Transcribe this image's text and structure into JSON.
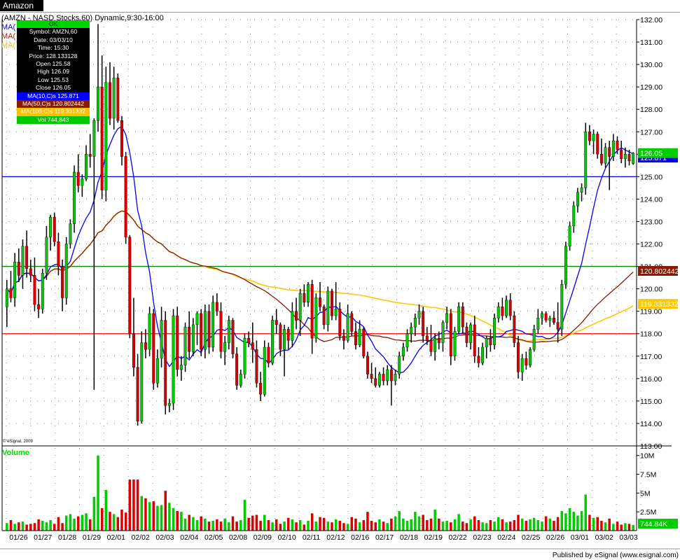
{
  "window": {
    "tab_title": "Amazon"
  },
  "header": {
    "text": "(AMZN - NASD Stocks,60) Dynamic,9:30-16:00"
  },
  "ma_labels": [
    {
      "text": "MA(",
      "color": "#0000ff"
    },
    {
      "text": "MA(",
      "color": "#b22000"
    },
    {
      "text": "MA(",
      "color": "#ffbe00"
    }
  ],
  "cursor": {
    "ok": "OK",
    "symbol": "Symbol: AMZN,60",
    "date": "Date: 03/03/10",
    "time": "Time: 15:30",
    "price": "Price: 128.133128",
    "open": "Open 125.58",
    "high": "High 126.09",
    "low": "Low 125.53",
    "close": "Close 126.05",
    "ma10": "MA(10,C)s 125.871",
    "ma50": "MA(50,C)s 120.802442",
    "ma100": "MA(100,C)s 119.331332",
    "vol": "Vol 744,843"
  },
  "volume_label": "Volume",
  "copyright": "© eSignal, 2009",
  "footer": "Published by eSignal (www.esignal.com)",
  "colors": {
    "up": "#00cc00",
    "down": "#dd0000",
    "ma10": "#0000ff",
    "ma50": "#8b1a00",
    "ma100": "#ffc800",
    "hline_blue": "#0000ff",
    "hline_green": "#008800",
    "hline_red": "#ff0000"
  },
  "chart_data": {
    "type": "candlestick",
    "price_axis": {
      "min": 113,
      "max": 132,
      "ticks": [
        "113.00",
        "114.00",
        "115.00",
        "116.00",
        "117.00",
        "118.00",
        "119.00",
        "120.00",
        "121.00",
        "122.00",
        "123.00",
        "124.00",
        "125.00",
        "126.00",
        "127.00",
        "128.00",
        "129.00",
        "130.00",
        "131.00",
        "132.00"
      ]
    },
    "volume_axis": {
      "ticks": [
        {
          "label": "2.5M",
          "value": 2.5
        },
        {
          "label": "5M",
          "value": 5
        },
        {
          "label": "7.5M",
          "value": 7.5
        },
        {
          "label": "10M",
          "value": 10
        }
      ]
    },
    "dates": [
      "01/26",
      "01/27",
      "01/28",
      "01/29",
      "02/01",
      "02/02",
      "02/03",
      "02/04",
      "02/05",
      "02/08",
      "02/09",
      "02/10",
      "02/11",
      "02/12",
      "02/16",
      "02/17",
      "02/18",
      "02/19",
      "02/22",
      "02/23",
      "02/24",
      "02/25",
      "02/26",
      "03/01",
      "03/02",
      "03/03"
    ],
    "last_price": "126.05",
    "last_price_hidden": "125.871",
    "ma50_last": "120.802442",
    "ma100_last": "119.331332",
    "last_volume": "744.84K",
    "horizontal_lines": [
      {
        "price": 125.0,
        "color": "blue"
      },
      {
        "price": 121.0,
        "color": "green"
      },
      {
        "price": 118.0,
        "color": "red"
      }
    ],
    "bars": [
      [
        119.2,
        120.4,
        118.3,
        120.0,
        1.0
      ],
      [
        120.0,
        120.8,
        119.4,
        119.6,
        1.4
      ],
      [
        119.6,
        121.6,
        119.2,
        121.2,
        0.9
      ],
      [
        121.2,
        121.8,
        120.3,
        120.6,
        1.1
      ],
      [
        120.6,
        122.2,
        120.0,
        121.9,
        1.2
      ],
      [
        121.9,
        122.6,
        120.5,
        120.9,
        0.8
      ],
      [
        120.9,
        121.3,
        120.3,
        120.6,
        0.9
      ],
      [
        120.6,
        121.4,
        119.0,
        119.3,
        1.0
      ],
      [
        119.3,
        120.0,
        118.7,
        119.1,
        1.5
      ],
      [
        119.1,
        120.9,
        118.9,
        120.7,
        1.3
      ],
      [
        120.7,
        122.8,
        120.4,
        122.3,
        1.1
      ],
      [
        122.3,
        123.3,
        121.7,
        123.2,
        1.4
      ],
      [
        123.2,
        123.4,
        121.9,
        122.1,
        0.9
      ],
      [
        122.1,
        122.5,
        120.6,
        121.0,
        1.8
      ],
      [
        121.0,
        121.3,
        119.0,
        119.6,
        1.0
      ],
      [
        119.6,
        122.3,
        119.3,
        122.0,
        2.0
      ],
      [
        122.0,
        123.1,
        121.8,
        122.9,
        2.2
      ],
      [
        122.9,
        125.5,
        122.5,
        125.2,
        1.6
      ],
      [
        125.2,
        126.0,
        124.3,
        124.6,
        1.9
      ],
      [
        124.6,
        125.1,
        124.1,
        124.9,
        2.1
      ],
      [
        124.9,
        126.4,
        124.8,
        126.0,
        2.3
      ],
      [
        126.0,
        126.9,
        125.4,
        125.9,
        1.5
      ],
      [
        125.9,
        127.6,
        115.5,
        127.5,
        4.5
      ],
      [
        127.5,
        131.8,
        127.0,
        129.0,
        10.0
      ],
      [
        129.0,
        130.4,
        124.0,
        124.4,
        3.0
      ],
      [
        124.4,
        129.9,
        123.9,
        129.2,
        5.4
      ],
      [
        129.2,
        130.1,
        127.3,
        127.6,
        2.5
      ],
      [
        127.6,
        129.9,
        127.1,
        129.4,
        2.2
      ],
      [
        129.4,
        129.6,
        127.4,
        127.5,
        1.8
      ],
      [
        127.5,
        127.7,
        125.5,
        125.9,
        2.8
      ],
      [
        125.9,
        126.1,
        122.0,
        122.3,
        2.4
      ],
      [
        122.3,
        122.4,
        117.8,
        118.0,
        6.8
      ],
      [
        118.0,
        119.6,
        116.1,
        116.5,
        6.8
      ],
      [
        116.5,
        117.1,
        113.9,
        114.1,
        6.8
      ],
      [
        114.1,
        118.1,
        114.0,
        117.6,
        4.6
      ],
      [
        117.6,
        118.2,
        116.9,
        117.3,
        4.3
      ],
      [
        117.3,
        119.2,
        117.0,
        118.9,
        3.8
      ],
      [
        118.9,
        119.1,
        115.5,
        115.8,
        3.9
      ],
      [
        115.8,
        117.3,
        115.6,
        116.9,
        3.3
      ],
      [
        116.9,
        119.2,
        116.5,
        118.6,
        3.4
      ],
      [
        118.6,
        119.0,
        114.4,
        114.8,
        5.3
      ],
      [
        114.8,
        115.1,
        114.5,
        114.9,
        3.7
      ],
      [
        114.9,
        119.1,
        114.6,
        118.8,
        3.0
      ],
      [
        118.8,
        119.2,
        116.1,
        116.4,
        2.6
      ],
      [
        116.4,
        117.0,
        115.9,
        116.6,
        2.5
      ],
      [
        116.6,
        118.5,
        116.3,
        118.3,
        1.6
      ],
      [
        118.3,
        119.0,
        116.9,
        117.2,
        2.1
      ],
      [
        117.2,
        118.7,
        117.0,
        118.4,
        1.8
      ],
      [
        118.4,
        119.0,
        117.5,
        118.9,
        1.4
      ],
      [
        118.9,
        119.1,
        117.0,
        117.3,
        1.9
      ],
      [
        117.3,
        119.3,
        116.9,
        119.0,
        1.6
      ],
      [
        119.0,
        119.3,
        117.1,
        117.4,
        1.2
      ],
      [
        117.4,
        119.7,
        117.2,
        119.4,
        1.3
      ],
      [
        119.4,
        119.8,
        118.8,
        119.0,
        1.5
      ],
      [
        119.0,
        119.4,
        116.9,
        117.2,
        1.2
      ],
      [
        117.2,
        117.9,
        116.6,
        117.6,
        1.6
      ],
      [
        117.6,
        118.8,
        117.3,
        118.6,
        1.1
      ],
      [
        118.6,
        118.7,
        116.9,
        117.1,
        1.9
      ],
      [
        117.1,
        117.4,
        115.5,
        115.7,
        1.2
      ],
      [
        115.7,
        116.4,
        115.6,
        116.2,
        1.4
      ],
      [
        116.2,
        118.0,
        116.0,
        117.8,
        4.1
      ],
      [
        117.8,
        118.1,
        117.4,
        117.6,
        1.7
      ],
      [
        117.6,
        118.5,
        116.7,
        117.3,
        2.0
      ],
      [
        117.3,
        117.7,
        115.6,
        115.8,
        2.1
      ],
      [
        115.8,
        116.3,
        115.0,
        115.3,
        1.3
      ],
      [
        115.3,
        117.7,
        115.2,
        117.4,
        2.1
      ],
      [
        117.4,
        117.6,
        116.5,
        116.7,
        1.4
      ],
      [
        116.7,
        118.8,
        116.6,
        118.6,
        1.1
      ],
      [
        118.6,
        119.1,
        118.0,
        118.4,
        1.5
      ],
      [
        118.4,
        118.5,
        117.0,
        117.3,
        0.9
      ],
      [
        117.3,
        118.4,
        116.1,
        118.2,
        1.2
      ],
      [
        118.2,
        118.3,
        117.3,
        117.7,
        1.7
      ],
      [
        117.7,
        119.4,
        117.4,
        119.0,
        1.5
      ],
      [
        119.0,
        119.6,
        118.2,
        118.6,
        1.1
      ],
      [
        118.6,
        120.0,
        117.9,
        119.8,
        1.4
      ],
      [
        119.8,
        120.2,
        119.2,
        119.4,
        0.8
      ],
      [
        119.4,
        120.3,
        119.2,
        120.2,
        1.3
      ],
      [
        120.2,
        120.4,
        117.1,
        117.8,
        2.3
      ],
      [
        117.8,
        119.8,
        117.6,
        119.6,
        1.2
      ],
      [
        119.6,
        120.3,
        119.0,
        119.2,
        1.8
      ],
      [
        119.2,
        119.3,
        118.2,
        118.4,
        1.7
      ],
      [
        118.4,
        120.1,
        118.1,
        119.9,
        1.2
      ],
      [
        119.9,
        120.0,
        118.6,
        118.8,
        1.1
      ],
      [
        118.8,
        120.3,
        118.6,
        119.1,
        1.5
      ],
      [
        119.1,
        119.4,
        117.7,
        117.9,
        1.3
      ],
      [
        117.9,
        118.2,
        117.3,
        117.7,
        1.0
      ],
      [
        117.7,
        119.3,
        117.6,
        118.9,
        0.9
      ],
      [
        118.9,
        119.0,
        117.9,
        118.1,
        1.8
      ],
      [
        118.1,
        118.5,
        117.3,
        117.5,
        1.6
      ],
      [
        117.5,
        118.6,
        117.4,
        118.2,
        1.1
      ],
      [
        118.2,
        118.3,
        116.9,
        117.0,
        1.4
      ],
      [
        117.0,
        117.2,
        116.0,
        116.2,
        2.5
      ],
      [
        116.2,
        116.7,
        115.8,
        116.0,
        1.3
      ],
      [
        116.0,
        116.5,
        115.6,
        115.7,
        1.1
      ],
      [
        115.7,
        116.3,
        115.6,
        116.2,
        1.5
      ],
      [
        116.2,
        116.5,
        115.7,
        115.9,
        1.2
      ],
      [
        115.9,
        116.6,
        115.7,
        116.4,
        1.0
      ],
      [
        116.4,
        116.6,
        114.8,
        115.9,
        1.6
      ],
      [
        115.9,
        116.4,
        115.7,
        116.2,
        1.9
      ],
      [
        116.2,
        117.2,
        116.0,
        117.0,
        2.6
      ],
      [
        117.0,
        117.6,
        116.8,
        117.4,
        1.6
      ],
      [
        117.4,
        118.2,
        117.2,
        118.0,
        1.3
      ],
      [
        118.0,
        118.5,
        117.6,
        118.3,
        1.5
      ],
      [
        118.3,
        118.9,
        117.9,
        118.7,
        2.5
      ],
      [
        118.7,
        119.3,
        118.4,
        119.0,
        1.9
      ],
      [
        119.0,
        119.2,
        117.6,
        117.9,
        2.1
      ],
      [
        117.9,
        118.3,
        117.5,
        117.7,
        1.4
      ],
      [
        117.7,
        118.4,
        117.0,
        117.2,
        1.6
      ],
      [
        117.2,
        118.0,
        116.8,
        117.8,
        2.8
      ],
      [
        117.8,
        118.1,
        117.3,
        117.6,
        1.6
      ],
      [
        117.6,
        118.6,
        117.2,
        118.5,
        1.2
      ],
      [
        118.5,
        119.2,
        118.2,
        118.9,
        1.3
      ],
      [
        118.9,
        119.1,
        116.6,
        117.0,
        1.1
      ],
      [
        117.0,
        118.3,
        116.8,
        118.1,
        1.5
      ],
      [
        118.1,
        119.4,
        118.0,
        119.2,
        2.2
      ],
      [
        119.2,
        119.4,
        118.0,
        118.3,
        1.2
      ],
      [
        118.3,
        118.5,
        117.4,
        117.6,
        1.0
      ],
      [
        117.6,
        118.5,
        117.3,
        118.4,
        1.5
      ],
      [
        118.4,
        118.8,
        116.7,
        117.0,
        1.9
      ],
      [
        117.0,
        117.4,
        116.5,
        116.7,
        1.4
      ],
      [
        116.7,
        117.6,
        116.6,
        117.4,
        1.1
      ],
      [
        117.4,
        117.9,
        116.9,
        117.8,
        1.0
      ],
      [
        117.8,
        118.2,
        117.2,
        117.5,
        1.4
      ],
      [
        117.5,
        118.9,
        117.3,
        118.7,
        1.2
      ],
      [
        118.7,
        119.4,
        118.5,
        119.2,
        1.8
      ],
      [
        119.2,
        119.6,
        118.6,
        118.8,
        1.5
      ],
      [
        118.8,
        119.7,
        118.7,
        119.5,
        1.1
      ],
      [
        119.5,
        119.8,
        118.6,
        118.8,
        1.2
      ],
      [
        118.8,
        119.0,
        117.4,
        117.6,
        1.4
      ],
      [
        117.6,
        117.9,
        116.0,
        116.3,
        2.1
      ],
      [
        116.3,
        117.1,
        115.9,
        116.9,
        1.6
      ],
      [
        116.9,
        117.2,
        116.4,
        116.6,
        1.3
      ],
      [
        116.6,
        117.4,
        116.5,
        117.3,
        1.5
      ],
      [
        117.3,
        118.4,
        117.2,
        118.2,
        1.7
      ],
      [
        118.2,
        119.1,
        118.0,
        118.7,
        1.4
      ],
      [
        118.7,
        119.0,
        118.4,
        118.9,
        1.2
      ],
      [
        118.9,
        119.0,
        118.5,
        118.6,
        1.9
      ],
      [
        118.6,
        118.8,
        118.3,
        118.7,
        1.6
      ],
      [
        118.7,
        119.0,
        118.4,
        118.5,
        1.3
      ],
      [
        118.5,
        119.4,
        117.6,
        118.2,
        1.8
      ],
      [
        118.2,
        120.4,
        117.9,
        120.2,
        2.6
      ],
      [
        120.2,
        122.1,
        120.0,
        121.9,
        2.3
      ],
      [
        121.9,
        123.0,
        121.7,
        122.8,
        3.0
      ],
      [
        122.8,
        123.9,
        122.5,
        123.7,
        2.5
      ],
      [
        123.7,
        124.5,
        123.4,
        124.3,
        2.0
      ],
      [
        124.3,
        124.7,
        123.9,
        124.5,
        2.6
      ],
      [
        124.5,
        127.4,
        124.2,
        127.0,
        4.8
      ],
      [
        127.0,
        127.3,
        126.4,
        126.6,
        2.1
      ],
      [
        126.6,
        127.1,
        126.0,
        126.9,
        1.7
      ],
      [
        126.9,
        127.0,
        125.8,
        126.0,
        1.8
      ],
      [
        126.0,
        126.7,
        125.5,
        125.6,
        1.3
      ],
      [
        125.6,
        126.5,
        125.4,
        126.3,
        1.1
      ],
      [
        126.3,
        126.6,
        124.4,
        125.9,
        1.6
      ],
      [
        125.9,
        126.9,
        125.7,
        126.6,
        0.9
      ],
      [
        126.6,
        126.8,
        126.0,
        126.2,
        1.2
      ],
      [
        126.2,
        126.6,
        125.6,
        125.8,
        0.8
      ],
      [
        125.8,
        126.3,
        125.4,
        126.0,
        1.0
      ],
      [
        126.0,
        126.2,
        125.5,
        125.7,
        0.9
      ],
      [
        125.58,
        126.09,
        125.53,
        126.05,
        0.74
      ]
    ]
  }
}
